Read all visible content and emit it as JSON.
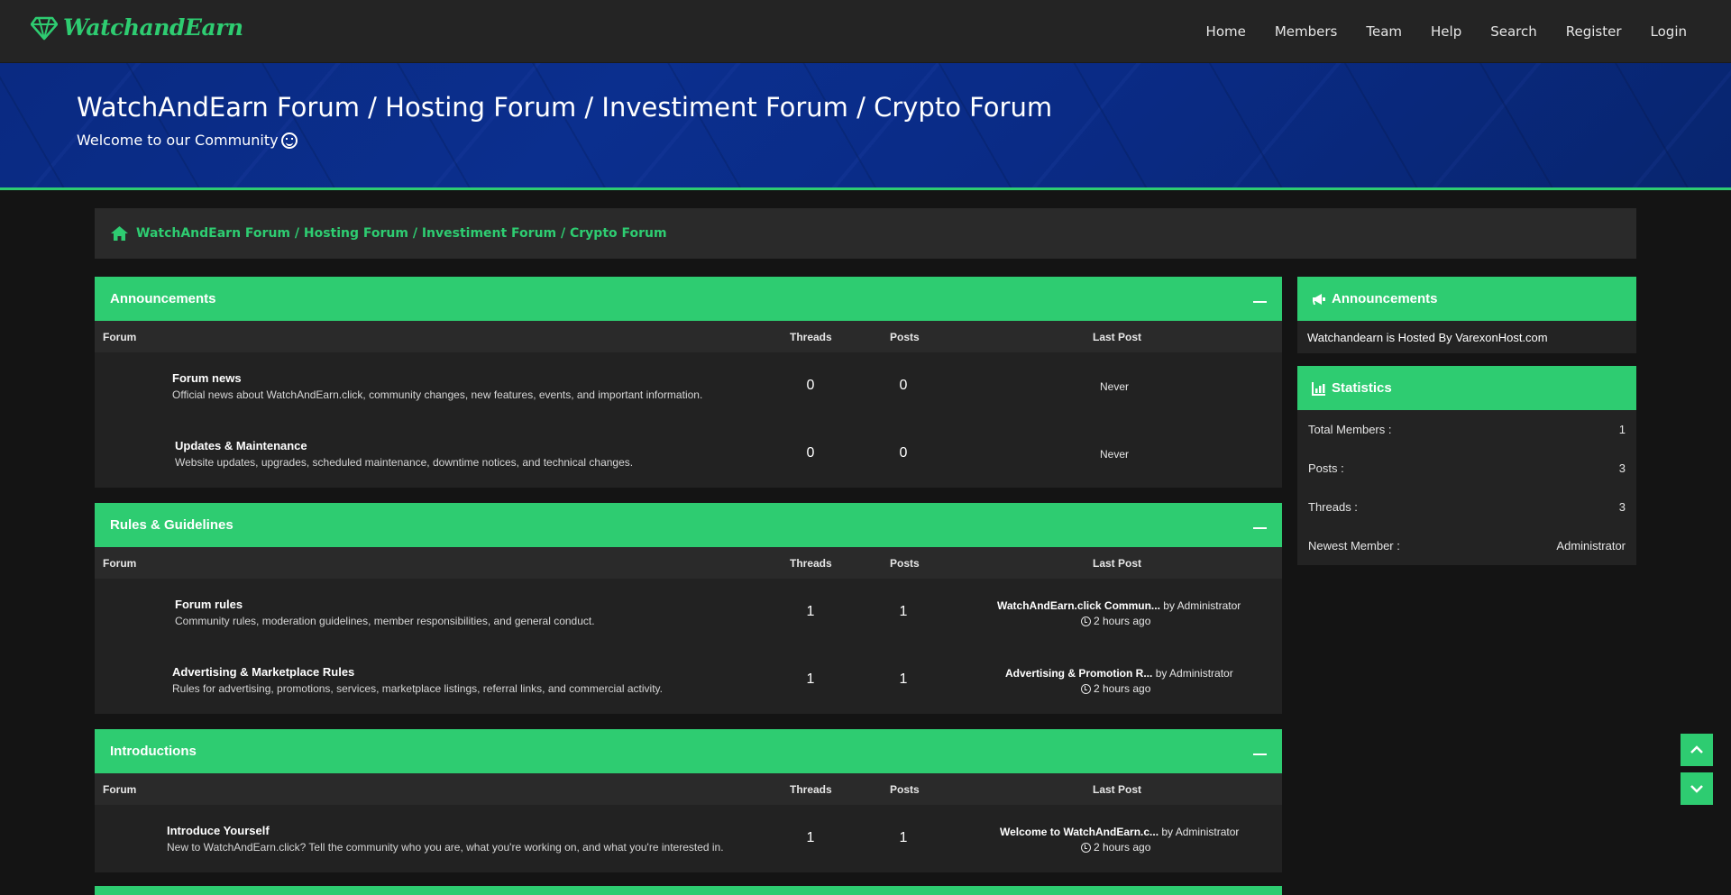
{
  "brand": {
    "logo_text": "WatchandEarn",
    "accent": "#2ecc71"
  },
  "nav": {
    "items": [
      "Home",
      "Members",
      "Team",
      "Help",
      "Search",
      "Register",
      "Login"
    ]
  },
  "hero": {
    "title": "WatchAndEarn Forum / Hosting Forum / Investiment Forum / Crypto Forum",
    "subtitle": "Welcome to our Community"
  },
  "breadcrumb": {
    "text": "WatchAndEarn Forum / Hosting Forum / Investiment Forum / Crypto Forum"
  },
  "columns": {
    "forum": "Forum",
    "threads": "Threads",
    "posts": "Posts",
    "last_post": "Last Post"
  },
  "categories": [
    {
      "title": "Announcements",
      "forums": [
        {
          "name": "Forum news",
          "description": "Official news about WatchAndEarn.click, community changes, new features, events, and important information.",
          "threads": "0",
          "posts": "0",
          "last_post": "Never"
        },
        {
          "name": "Updates & Maintenance",
          "description": "Website updates, upgrades, scheduled maintenance, downtime notices, and technical changes.",
          "threads": "0",
          "posts": "0",
          "last_post": "Never"
        }
      ]
    },
    {
      "title": "Rules & Guidelines",
      "forums": [
        {
          "name": "Forum rules",
          "description": "Community rules, moderation guidelines, member responsibilities, and general conduct.",
          "threads": "1",
          "posts": "1",
          "last_post_title": "WatchAndEarn.click Commun...",
          "last_post_by": "by Administrator",
          "last_post_time": "2 hours ago"
        },
        {
          "name": "Advertising & Marketplace Rules",
          "description": "Rules for advertising, promotions, services, marketplace listings, referral links, and commercial activity.",
          "threads": "1",
          "posts": "1",
          "last_post_title": "Advertising & Promotion R...",
          "last_post_by": "by Administrator",
          "last_post_time": "2 hours ago"
        }
      ]
    },
    {
      "title": "Introductions",
      "forums": [
        {
          "name": "Introduce Yourself",
          "description": "New to WatchAndEarn.click? Tell the community who you are, what you're working on, and what you're interested in.",
          "threads": "1",
          "posts": "1",
          "last_post_title": "Welcome to WatchAndEarn.c...",
          "last_post_by": "by Administrator",
          "last_post_time": "2 hours ago"
        }
      ]
    }
  ],
  "sidebar": {
    "announcements": {
      "title": "Announcements",
      "text": "Watchandearn is Hosted By VarexonHost.com"
    },
    "statistics": {
      "title": "Statistics",
      "rows": [
        {
          "label": "Total Members :",
          "value": "1"
        },
        {
          "label": "Posts :",
          "value": "3"
        },
        {
          "label": "Threads :",
          "value": "3"
        },
        {
          "label": "Newest Member :",
          "value": "Administrator"
        }
      ]
    }
  }
}
